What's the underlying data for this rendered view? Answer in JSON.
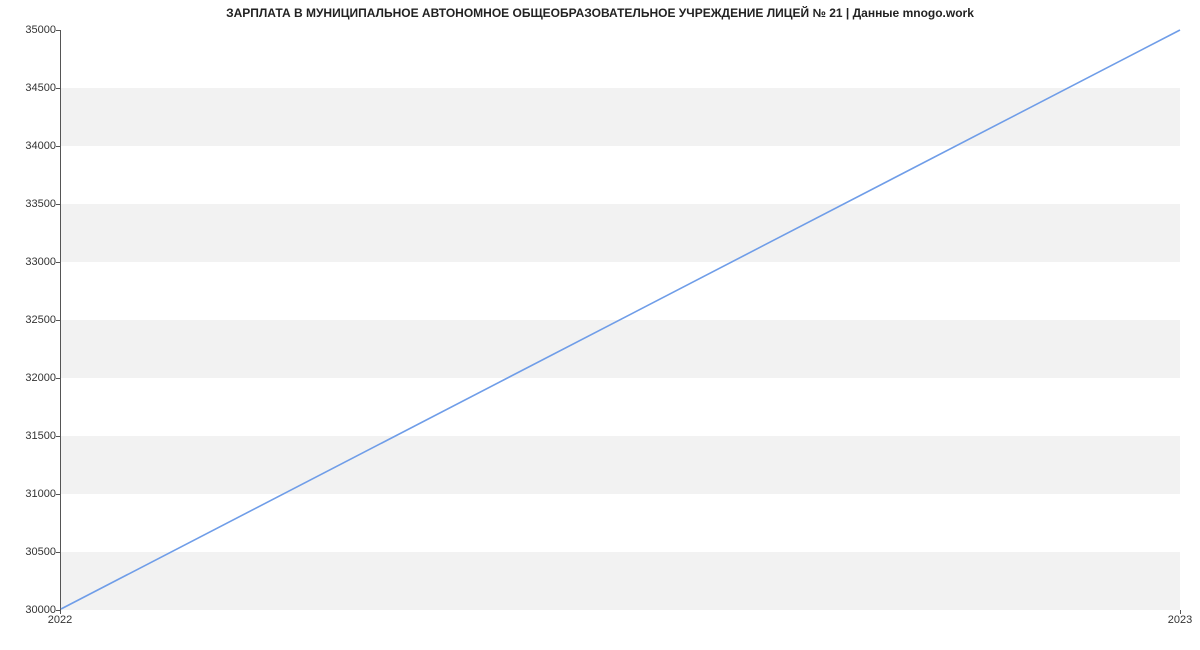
{
  "chart_data": {
    "type": "line",
    "title": "ЗАРПЛАТА В МУНИЦИПАЛЬНОЕ АВТОНОМНОЕ ОБЩЕОБРАЗОВАТЕЛЬНОЕ УЧРЕЖДЕНИЕ ЛИЦЕЙ № 21 | Данные mnogo.work",
    "xlabel": "",
    "ylabel": "",
    "x_categories": [
      "2022",
      "2023"
    ],
    "y_ticks": [
      30000,
      30500,
      31000,
      31500,
      32000,
      32500,
      33000,
      33500,
      34000,
      34500,
      35000
    ],
    "ylim": [
      30000,
      35000
    ],
    "series": [
      {
        "name": "salary",
        "color": "#6f9de8",
        "values": [
          30000,
          35000
        ]
      }
    ],
    "grid": {
      "horizontal_bands": true
    }
  }
}
